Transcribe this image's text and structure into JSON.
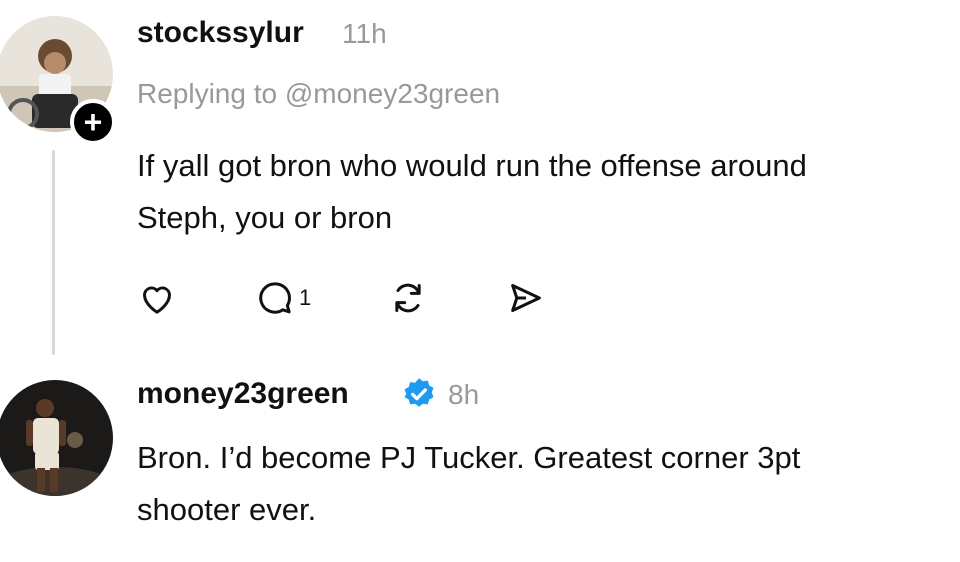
{
  "posts": [
    {
      "username": "stockssylur",
      "time": "11h",
      "replying_to": "Replying to @money23green",
      "text_line1": "If yall got bron who would run the offense around",
      "text_line2": "Steph, you or bron",
      "follow_symbol": "+",
      "actions": {
        "like_icon": "heart-icon",
        "reply_icon": "comment-icon",
        "reply_count": "1",
        "repost_icon": "repost-icon",
        "share_icon": "send-icon"
      }
    },
    {
      "username": "money23green",
      "verified": true,
      "time": "8h",
      "text_line1": "Bron. I’d become PJ Tucker. Greatest corner 3pt",
      "text_line2": "shooter ever."
    }
  ],
  "colors": {
    "text": "#111111",
    "muted": "#999999",
    "verified_blue": "#1d9bf0",
    "thread_line": "#d9d9d9"
  }
}
